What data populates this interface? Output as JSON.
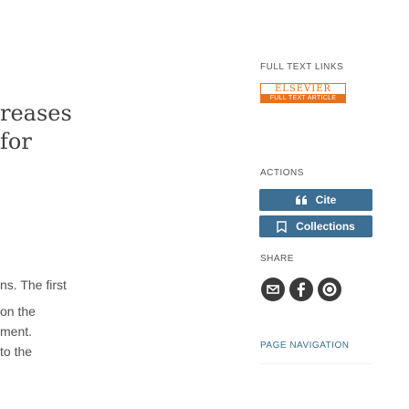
{
  "left_column": {
    "heading_line1": "reases",
    "heading_line2": "for",
    "body_lines": [
      "ns. The first",
      "on the",
      "ment.",
      "to the"
    ]
  },
  "full_text_links": {
    "section_label": "FULL TEXT LINKS",
    "publisher_logo": {
      "name": "ELSEVIER",
      "caption": "FULL TEXT ARTICLE",
      "color": "#e9711c"
    }
  },
  "actions": {
    "section_label": "ACTIONS",
    "cite_label": "Cite",
    "collections_label": "Collections",
    "button_color": "#3d6e94"
  },
  "share": {
    "section_label": "SHARE",
    "icons": [
      "email-icon",
      "facebook-icon",
      "reddit-icon"
    ]
  },
  "page_navigation": {
    "section_label": "PAGE NAVIGATION"
  }
}
